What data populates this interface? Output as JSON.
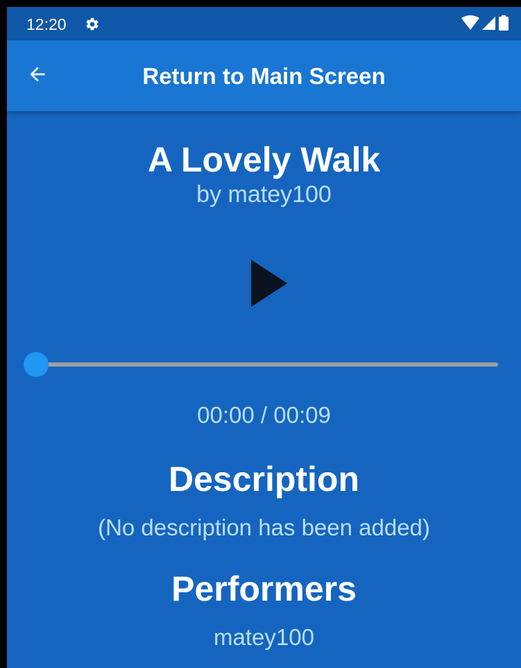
{
  "status_bar": {
    "time": "12:20",
    "left_icons": [
      "gear-icon"
    ],
    "right_icons": [
      "wifi-icon",
      "cellular-signal-icon",
      "battery-icon"
    ]
  },
  "app_bar": {
    "back_icon": "arrow-left-icon",
    "title": "Return to Main Screen"
  },
  "track": {
    "title": "A Lovely Walk",
    "author": "by matey100"
  },
  "player": {
    "play_icon": "play-icon",
    "progress_fraction": 0,
    "time_readout": "00:00 / 00:09"
  },
  "description": {
    "heading": "Description",
    "text": "(No description has been added)"
  },
  "performers": {
    "heading": "Performers",
    "names": [
      "matey100"
    ]
  },
  "colors": {
    "status_bar": "#0f58a8",
    "app_bar": "#1976d2",
    "background": "#1565c0",
    "accent": "#2196f3",
    "slider_track": "#9e9e9e",
    "play_icon": "#0b1220",
    "secondary_text": "#bbdefb"
  }
}
